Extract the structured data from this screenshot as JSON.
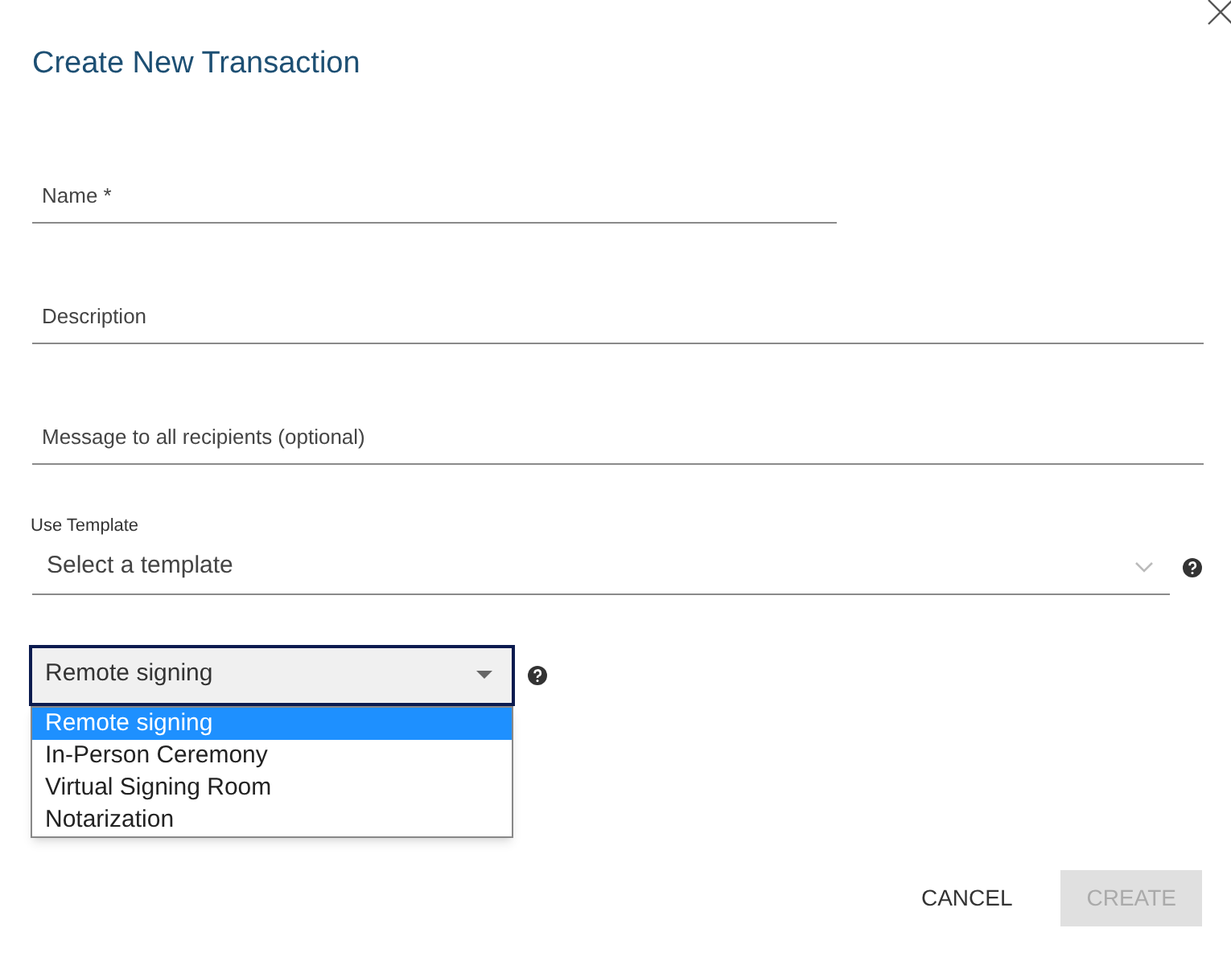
{
  "dialog": {
    "title": "Create New Transaction"
  },
  "fields": [
    {
      "placeholder": "Name *",
      "kind": "short"
    },
    {
      "placeholder": "Description",
      "kind": "full"
    },
    {
      "placeholder": "Message to all recipients (optional)",
      "kind": "full"
    }
  ],
  "template": {
    "label": "Use Template",
    "placeholder": "Select a template"
  },
  "signing_select": {
    "value": "Remote signing",
    "expanded": true,
    "options": [
      {
        "label": "Remote signing",
        "selected": true
      },
      {
        "label": "In-Person Ceremony",
        "selected": false
      },
      {
        "label": "Virtual Signing Room",
        "selected": false
      },
      {
        "label": "Notarization",
        "selected": false
      }
    ]
  },
  "buttons": [
    {
      "label": "CANCEL",
      "disabled": false
    },
    {
      "label": "CREATE",
      "disabled": true
    }
  ]
}
